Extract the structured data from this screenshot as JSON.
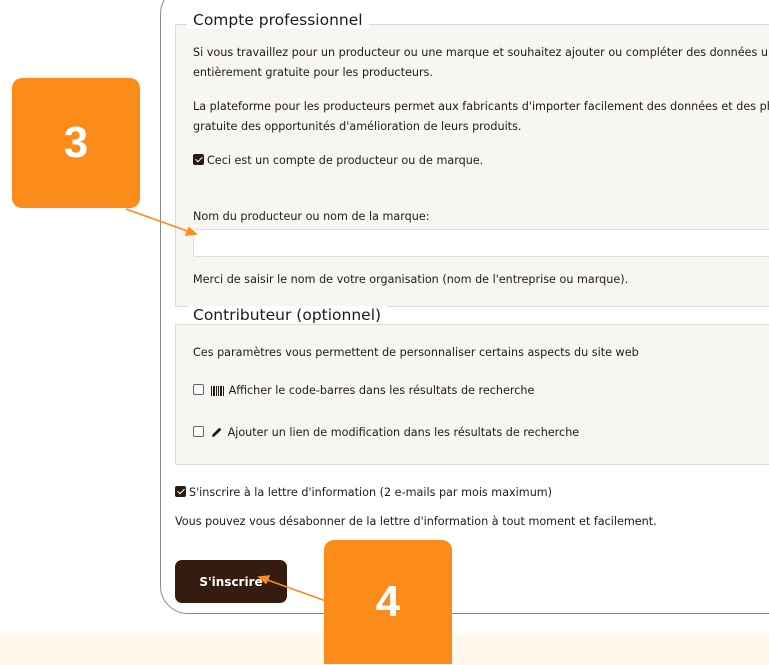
{
  "pro_section": {
    "legend": "Compte professionnel",
    "para1_line1": "Si vous travaillez pour un producteur ou une marque et souhaitez ajouter ou compléter des données unique",
    "para1_line2": "entièrement gratuite pour les producteurs.",
    "para2_line1": "La plateforme pour les producteurs permet aux fabricants d'importer facilement des données et des photos",
    "para2_line2": "gratuite des opportunités d'amélioration de leurs produits.",
    "producer_checkbox_label": "Ceci est un compte de producteur ou de marque.",
    "producer_checkbox_checked": true,
    "org_name_label": "Nom du producteur ou nom de la marque:",
    "org_name_value": "",
    "org_name_help": "Merci de saisir le nom de votre organisation (nom de l'entreprise ou marque)."
  },
  "contrib_section": {
    "legend": "Contributeur (optionnel)",
    "description": "Ces paramètres vous permettent de personnaliser certains aspects du site web",
    "barcode_label": "Afficher le code-barres dans les résultats de recherche",
    "barcode_checked": false,
    "barcode_icon": "barcode-icon",
    "edit_link_label": "Ajouter un lien de modification dans les résultats de recherche",
    "edit_link_checked": false,
    "edit_icon": "pencil-icon"
  },
  "newsletter": {
    "label": "S'inscrire à la lettre d'information (2 e-mails par mois maximum)",
    "checked": true,
    "note": "Vous pouvez vous désabonner de la lettre d'information à tout moment et facilement."
  },
  "submit_label": "S'inscrire",
  "annotations": {
    "badge_3": "3",
    "badge_4": "4",
    "accent_color": "#fb8c1a",
    "button_color": "#341c0e"
  }
}
